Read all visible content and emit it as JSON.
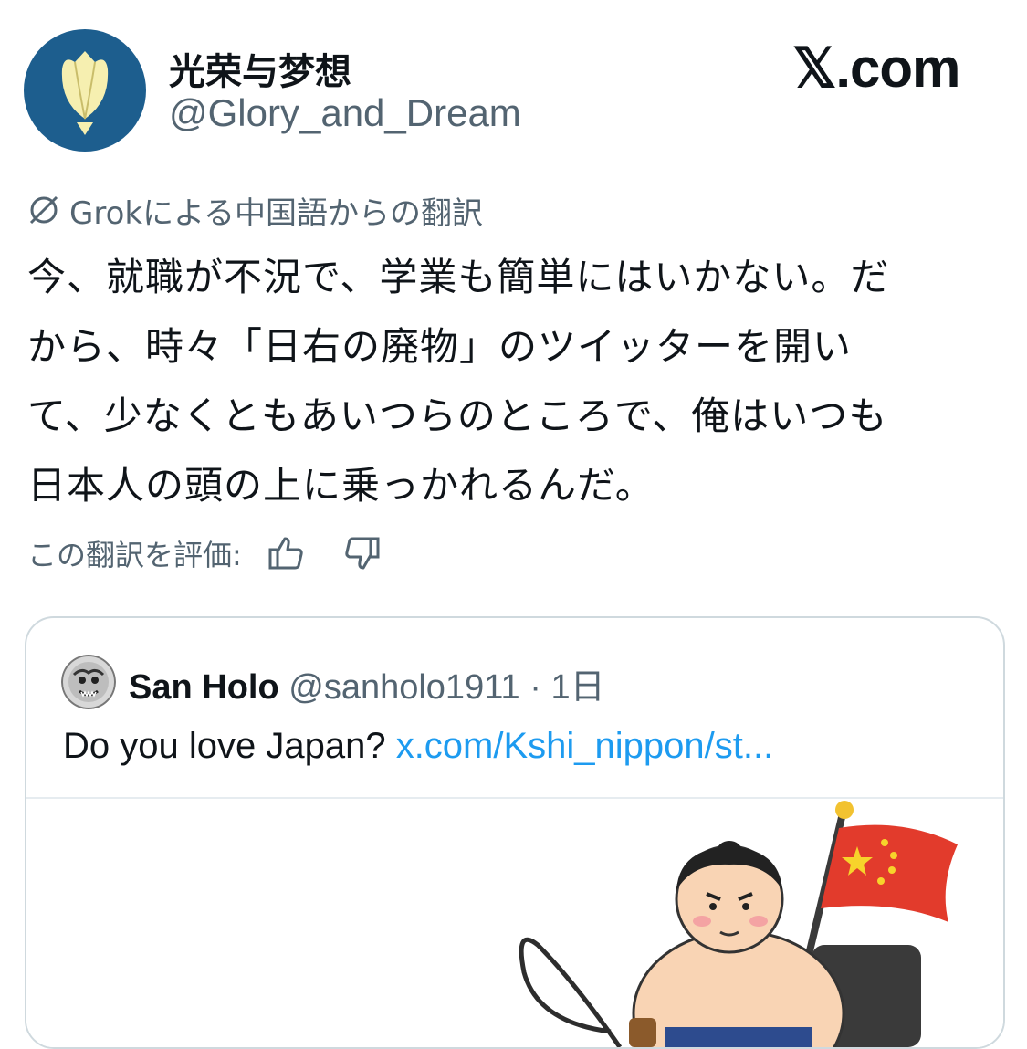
{
  "post": {
    "display_name": "光荣与梦想",
    "handle": "@Glory_and_Dream",
    "avatar_icon": "tulip-icon",
    "avatar_color": "#1d5e8e"
  },
  "brand": {
    "label": "𝕏.com"
  },
  "translation": {
    "icon": "grok-icon",
    "label": "Grokによる中国語からの翻訳"
  },
  "tweet": {
    "lines": [
      "今、就職が不況で、学業も簡単にはいかない。だ",
      "から、時々「日右の廃物」のツイッターを開い",
      "て、少なくともあいつらのところで、俺はいつも",
      "日本人の頭の上に乗っかれるんだ。"
    ]
  },
  "rating": {
    "label": "この翻訳を評価:",
    "like_icon": "thumbs-up-icon",
    "dislike_icon": "thumbs-down-icon"
  },
  "quote": {
    "name": "San Holo",
    "handle": "@sanholo1911",
    "separator": "·",
    "time": "1日",
    "text": "Do you love Japan? ",
    "link": "x.com/Kshi_nippon/st...",
    "link_color": "#1d9bf0"
  }
}
